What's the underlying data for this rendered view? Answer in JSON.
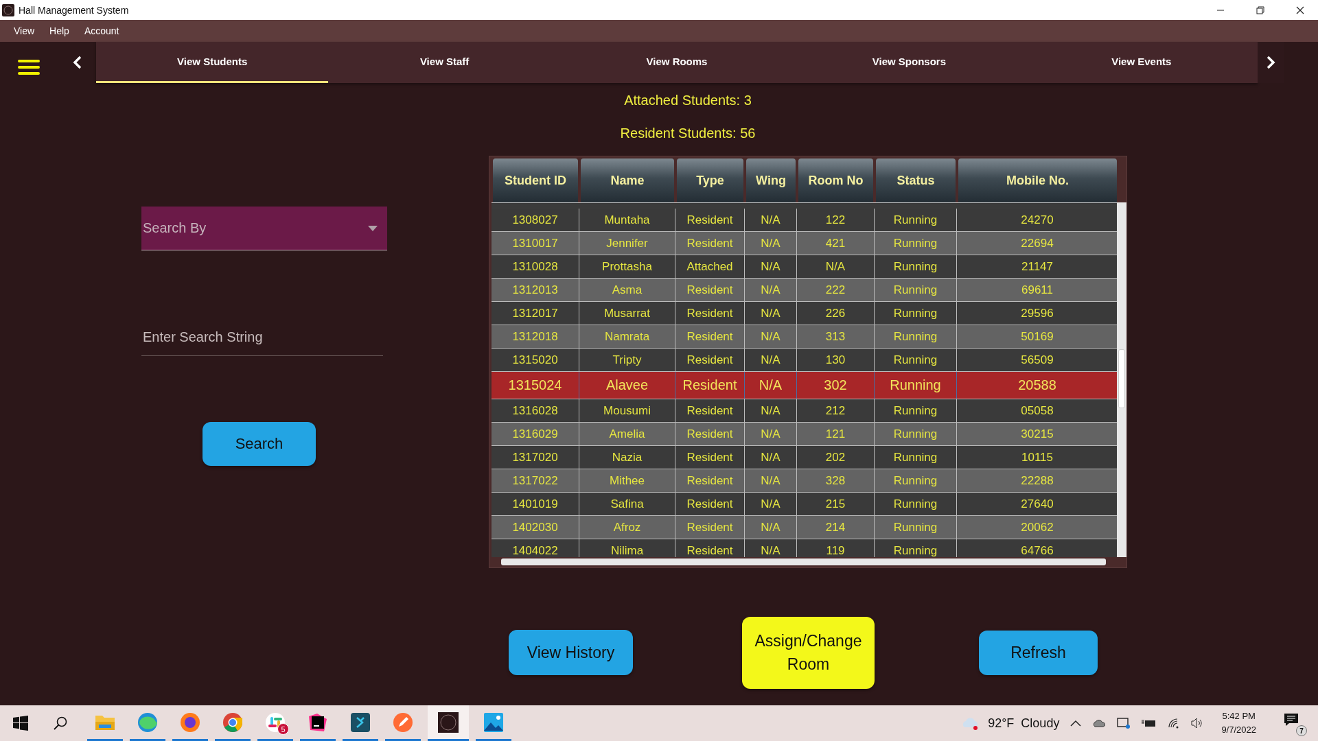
{
  "window": {
    "title": "Hall Management System"
  },
  "menu": [
    "View",
    "Help",
    "Account"
  ],
  "tabs": [
    {
      "label": "View Students",
      "selected": true
    },
    {
      "label": "View Staff",
      "selected": false
    },
    {
      "label": "View Rooms",
      "selected": false
    },
    {
      "label": "View Sponsors",
      "selected": false
    },
    {
      "label": "View Events",
      "selected": false
    }
  ],
  "stats": [
    "Attached Students: 3",
    "Resident Students: 56"
  ],
  "search_by": {
    "placeholder": "Search By"
  },
  "search_field": {
    "placeholder": "Enter Search String"
  },
  "search_button": "Search",
  "table": {
    "columns": [
      "Student ID",
      "Name",
      "Type",
      "Wing",
      "Room No",
      "Status",
      "Mobile No."
    ],
    "rows": [
      {
        "cells": [
          "1308027",
          "Muntaha",
          "Resident",
          "N/A",
          "122",
          "Running",
          "24270"
        ],
        "selected": false
      },
      {
        "cells": [
          "1310017",
          "Jennifer",
          "Resident",
          "N/A",
          "421",
          "Running",
          "22694"
        ],
        "selected": false
      },
      {
        "cells": [
          "1310028",
          "Prottasha",
          "Attached",
          "N/A",
          "N/A",
          "Running",
          "21147"
        ],
        "selected": false
      },
      {
        "cells": [
          "1312013",
          "Asma",
          "Resident",
          "N/A",
          "222",
          "Running",
          "69611"
        ],
        "selected": false
      },
      {
        "cells": [
          "1312017",
          "Musarrat",
          "Resident",
          "N/A",
          "226",
          "Running",
          "29596"
        ],
        "selected": false
      },
      {
        "cells": [
          "1312018",
          "Namrata",
          "Resident",
          "N/A",
          "313",
          "Running",
          "50169"
        ],
        "selected": false
      },
      {
        "cells": [
          "1315020",
          "Tripty",
          "Resident",
          "N/A",
          "130",
          "Running",
          "56509"
        ],
        "selected": false
      },
      {
        "cells": [
          "1315024",
          "Alavee",
          "Resident",
          "N/A",
          "302",
          "Running",
          "20588"
        ],
        "selected": true
      },
      {
        "cells": [
          "1316028",
          "Mousumi",
          "Resident",
          "N/A",
          "212",
          "Running",
          "05058"
        ],
        "selected": false
      },
      {
        "cells": [
          "1316029",
          "Amelia",
          "Resident",
          "N/A",
          "121",
          "Running",
          "30215"
        ],
        "selected": false
      },
      {
        "cells": [
          "1317020",
          "Nazia",
          "Resident",
          "N/A",
          "202",
          "Running",
          "10115"
        ],
        "selected": false
      },
      {
        "cells": [
          "1317022",
          "Mithee",
          "Resident",
          "N/A",
          "328",
          "Running",
          "22288"
        ],
        "selected": false
      },
      {
        "cells": [
          "1401019",
          "Safina",
          "Resident",
          "N/A",
          "215",
          "Running",
          "27640"
        ],
        "selected": false
      },
      {
        "cells": [
          "1402030",
          "Afroz",
          "Resident",
          "N/A",
          "214",
          "Running",
          "20062"
        ],
        "selected": false
      },
      {
        "cells": [
          "1404022",
          "Nilima",
          "Resident",
          "N/A",
          "119",
          "Running",
          "64766"
        ],
        "selected": false
      }
    ]
  },
  "actions": [
    {
      "label": "View History",
      "kind": "blue"
    },
    {
      "label": "Assign/Change Room",
      "kind": "yellow"
    },
    {
      "label": "Refresh",
      "kind": "blue"
    }
  ],
  "taskbar": {
    "apps": [
      {
        "kind": "folder",
        "selected": false
      },
      {
        "kind": "edge",
        "selected": false
      },
      {
        "kind": "firefox",
        "selected": false
      },
      {
        "kind": "chrome",
        "selected": false
      },
      {
        "kind": "slack",
        "selected": false,
        "badge": "5"
      },
      {
        "kind": "ide",
        "selected": false
      },
      {
        "kind": "tool",
        "selected": false
      },
      {
        "kind": "pen",
        "selected": false
      },
      {
        "kind": "hall",
        "selected": true
      },
      {
        "kind": "photos",
        "selected": false
      }
    ],
    "weather": {
      "temperature": "92°F",
      "condition": "Cloudy"
    },
    "time": "5:42 PM",
    "date": "9/7/2022",
    "notifications": "7"
  }
}
